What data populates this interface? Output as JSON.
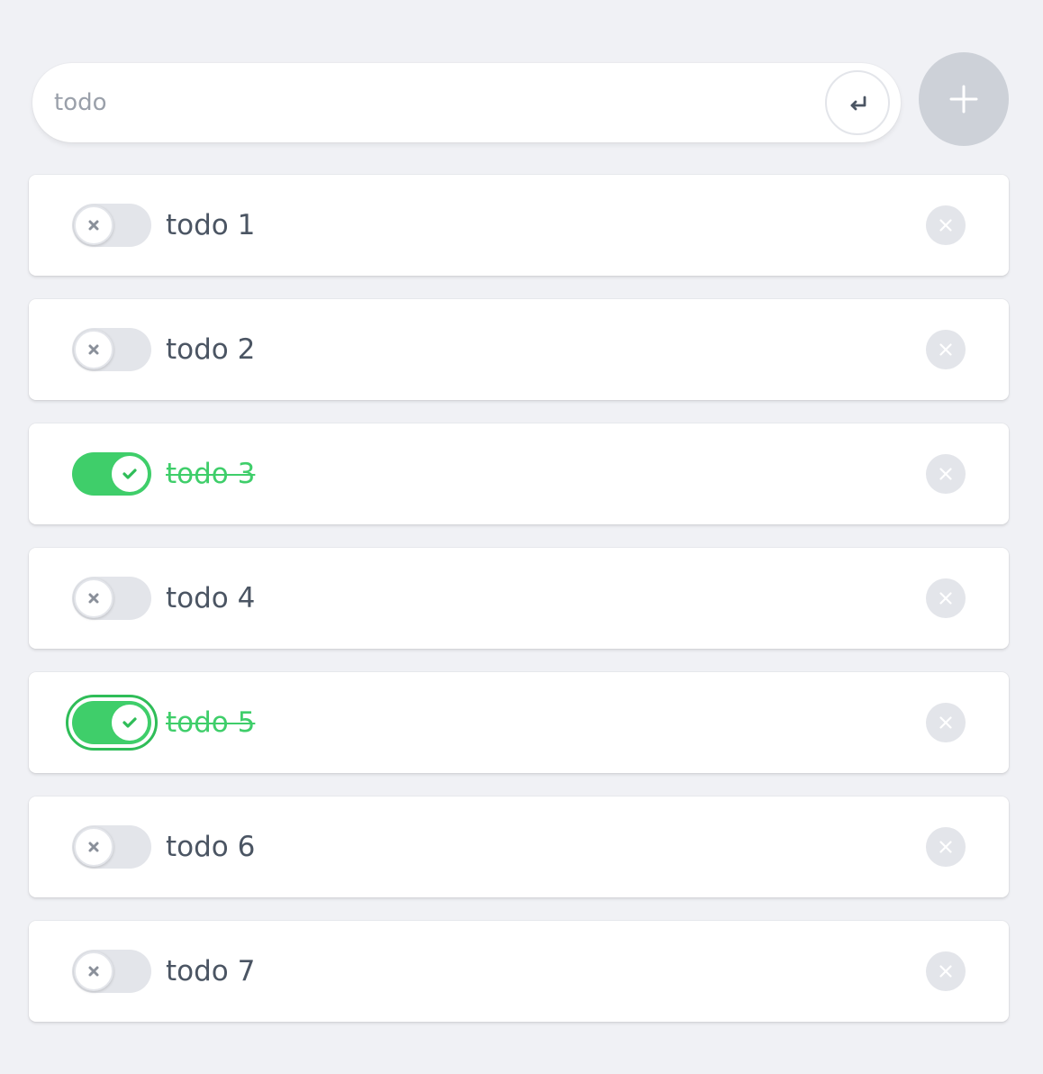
{
  "input": {
    "placeholder": "todo",
    "value": ""
  },
  "buttons": {
    "enter_icon": "enter-arrow-icon",
    "add_icon": "plus-icon"
  },
  "colors": {
    "accent_green": "#3fce6a",
    "inactive_toggle": "#e3e5ea",
    "background": "#f0f1f5"
  },
  "todos": [
    {
      "label": "todo 1",
      "done": false
    },
    {
      "label": "todo 2",
      "done": false
    },
    {
      "label": "todo 3",
      "done": true
    },
    {
      "label": "todo 4",
      "done": false
    },
    {
      "label": "todo 5",
      "done": true,
      "focused": true
    },
    {
      "label": "todo 6",
      "done": false
    },
    {
      "label": "todo 7",
      "done": false
    }
  ]
}
